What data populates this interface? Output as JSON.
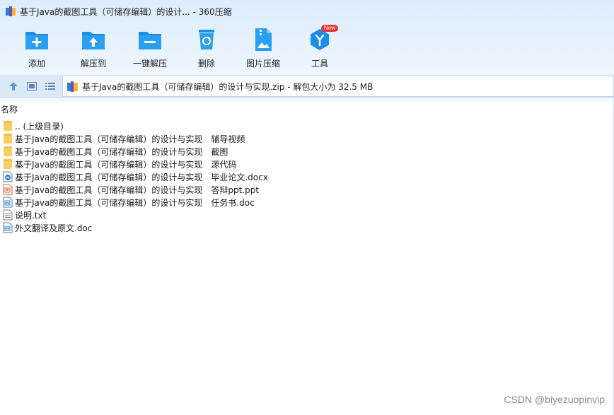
{
  "window": {
    "title": "基于Java的截图工具（可储存编辑）的设计... - 360压缩"
  },
  "toolbar": {
    "items": [
      {
        "label": "添加",
        "icon": "add-folder-icon"
      },
      {
        "label": "解压到",
        "icon": "extract-to-icon"
      },
      {
        "label": "一键解压",
        "icon": "one-click-extract-icon"
      },
      {
        "label": "删除",
        "icon": "recycle-bin-icon"
      },
      {
        "label": "图片压缩",
        "icon": "image-compress-icon"
      },
      {
        "label": "工具",
        "icon": "tools-icon",
        "badge": "New"
      }
    ]
  },
  "address_bar": {
    "path": "基于Java的截图工具（可储存编辑）的设计与实现.zip - 解包大小为 32.5 MB"
  },
  "file_list": {
    "column_name": "名称",
    "items": [
      {
        "name": ".. (上级目录)",
        "type": "folder"
      },
      {
        "name": "基于Java的截图工具（可储存编辑）的设计与实现　辅导视频",
        "type": "folder"
      },
      {
        "name": "基于Java的截图工具（可储存编辑）的设计与实现　截图",
        "type": "folder"
      },
      {
        "name": "基于Java的截图工具（可储存编辑）的设计与实现　源代码",
        "type": "folder"
      },
      {
        "name": "基于Java的截图工具（可储存编辑）的设计与实现　毕业论文.docx",
        "type": "docx"
      },
      {
        "name": "基于Java的截图工具（可储存编辑）的设计与实现　答辩ppt.ppt",
        "type": "ppt"
      },
      {
        "name": "基于Java的截图工具（可储存编辑）的设计与实现　任务书.doc",
        "type": "doc"
      },
      {
        "name": "说明.txt",
        "type": "txt"
      },
      {
        "name": "外文翻译及原文.doc",
        "type": "doc"
      }
    ]
  },
  "watermark": "CSDN @biyezuopinvip",
  "colors": {
    "accent": "#1c8ee6",
    "folder": "#f7cf62",
    "toolbar_bg": "#e3effc",
    "badge": "#e63232"
  }
}
